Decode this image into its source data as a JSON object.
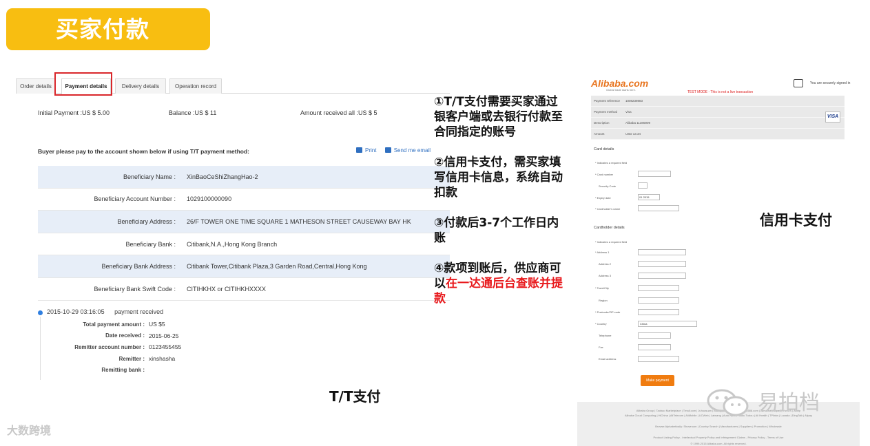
{
  "banner": {
    "title": "买家付款"
  },
  "left_panel": {
    "tabs": [
      "Order details",
      "Payment details",
      "Delivery details",
      "Operation record"
    ],
    "summary": {
      "initial": "Initial Payment :US $ 5.00",
      "balance": "Balance :US $ 11",
      "received": "Amount received all :US $ 5"
    },
    "instruction": "Buyer please pay to the account shown below if using T/T payment method:",
    "print_label": "Print",
    "send_label": "Send me email",
    "beneficiary_rows": [
      {
        "label": "Beneficiary Name :",
        "value": "XinBaoCeShiZhangHao-2"
      },
      {
        "label": "Beneficiary Account Number :",
        "value": "1029100000090"
      },
      {
        "label": "Beneficiary Address :",
        "value": "26/F TOWER ONE TIME SQUARE 1 MATHESON STREET CAUSEWAY BAY HK"
      },
      {
        "label": "Beneficiary Bank :",
        "value": "Citibank,N.A.,Hong Kong Branch"
      },
      {
        "label": "Beneficiary Bank Address :",
        "value": "Citibank Tower,Citibank Plaza,3 Garden Road,Central,Hong Kong"
      },
      {
        "label": "Beneficiary Bank Swift Code :",
        "value": "CITIHKHX or CITIHKHXXXX"
      }
    ],
    "timeline": {
      "datetime": "2015-10-29 03:16:05",
      "event": "payment received",
      "rows": [
        {
          "label": "Total payment amount :",
          "value": "US $5"
        },
        {
          "label": "Date received :",
          "value": "2015-06-25"
        },
        {
          "label": "Remitter account number :",
          "value": "0123455455"
        },
        {
          "label": "Remitter :",
          "value": "xinshasha"
        },
        {
          "label": "Remitting bank :",
          "value": ""
        }
      ]
    }
  },
  "notes": {
    "p1_lines": [
      "①T/T支付需要买家通过",
      "银客户端或去银行付款至",
      "合同指定的账号"
    ],
    "p2_lines": [
      "②信用卡支付，需买家填",
      "写信用卡信息，系统自动",
      "扣款"
    ],
    "p3_lines": [
      "③付款后3-7个工作日内",
      "账"
    ],
    "p4_line1": "④款项到账后，供应商可",
    "p4_line2_prefix": "以",
    "p4_line2_red": "在一达通后台查账并提",
    "p4_line3_red": "款"
  },
  "captions": {
    "tt": "T/T支付",
    "credit_card": "信用卡支付"
  },
  "right_panel": {
    "logo": "Alibaba.com",
    "logo_sub": "Global trade starts here.",
    "test_mode": "TEST MODE - This is not a live transaction",
    "secure_text": "You are securely signed in",
    "payment_summary": [
      {
        "label": "Payment reference",
        "value": "1008239883"
      },
      {
        "label": "Payment method",
        "value": "Visa"
      },
      {
        "label": "Description",
        "value": "Alibaba 11385909"
      },
      {
        "label": "Amount",
        "value": "USD 13.34"
      }
    ],
    "card_logo": "VISA",
    "card_details_title": "Card details",
    "required_note": "* Indicates a required field",
    "card_fields": [
      "* Card number",
      "Security Code",
      "* Expiry date",
      "* Cardholder's name"
    ],
    "expiry_values": [
      "01",
      "2015"
    ],
    "cardholder_title": "Cardholder details",
    "cardholder_fields": [
      "* Address 1",
      "Address 2",
      "Address 3",
      "* Town/City",
      "Region",
      "* Postcode/ZIP code",
      "* Country",
      "Telephone",
      "Fax",
      "Email address"
    ],
    "country_value": "China",
    "make_payment": "Make payment",
    "footer_lines": [
      "Alibaba Group | Taobao Marketplace | Tmall.com | Juhuasuan | AliExpress | Alibaba.com | 1688.com | Alimama | Alipay | YunOS | Alitrip",
      "Alibaba Cloud Computing | HiChina | AliTelecom | AliMobile | UCWeb | Laiwang | Auto Navi | Youku Tudou | Ali Health | TPlinks | Lazada | DingTalk | Alipay",
      "Browse Alphabetically: Showroom | Country Search | Manufacturers | Suppliers | Promotion | Wholesale",
      "Product Listing Policy - Intellectual Property Policy and Infringement Claims - Privacy Policy - Terms of Use",
      "© 1999-2015 Alibaba.com. All rights reserved."
    ]
  },
  "watermarks": {
    "left": "大数跨境",
    "right": "易拍档"
  }
}
